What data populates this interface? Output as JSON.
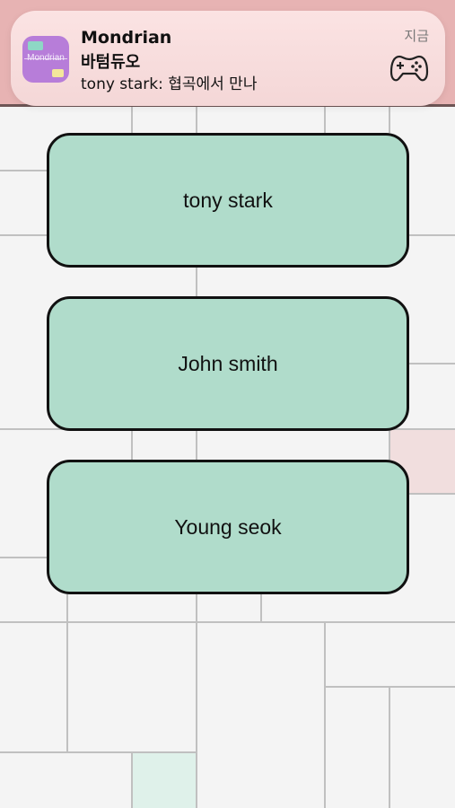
{
  "notification": {
    "app_name": "Mondrian",
    "app_icon_text": "Mondrian",
    "title": "바텀듀오",
    "message": "tony stark: 협곡에서 만나",
    "time": "지금",
    "icon": "gamepad-icon"
  },
  "players": [
    {
      "name": "tony stark"
    },
    {
      "name": "John smith"
    },
    {
      "name": "Young seok"
    }
  ],
  "colors": {
    "header": "#e7b3b3",
    "button_fill": "#b0dccb",
    "app_icon": "#b77dd9",
    "tile_pink": "#f1dede",
    "tile_mint": "#dff1ea"
  }
}
